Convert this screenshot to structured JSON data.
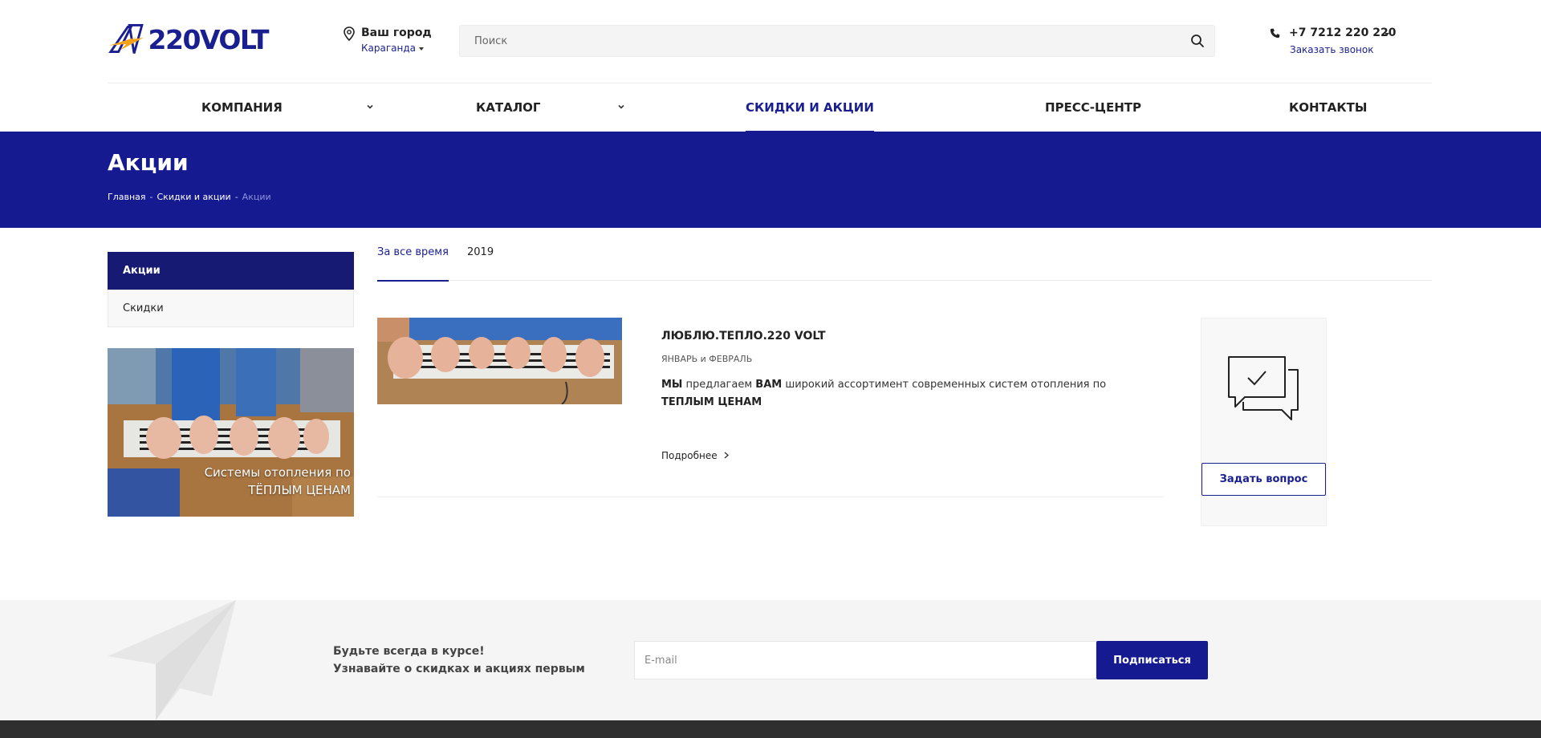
{
  "header": {
    "logo_text": "220VOLT",
    "city_label": "Ваш город",
    "city_value": "Караганда",
    "search_placeholder": "Поиск",
    "phone": "+7 7212 220 220",
    "callback": "Заказать звонок"
  },
  "nav": {
    "items": [
      {
        "label": "КОМПАНИЯ",
        "has_dropdown": true
      },
      {
        "label": "КАТАЛОГ",
        "has_dropdown": true
      },
      {
        "label": "СКИДКИ И АКЦИИ",
        "active": true
      },
      {
        "label": "ПРЕСС-ЦЕНТР"
      },
      {
        "label": "КОНТАКТЫ"
      }
    ]
  },
  "banner": {
    "title": "Акции",
    "breadcrumb": [
      "Главная",
      "Скидки и акции",
      "Акции"
    ],
    "separator": "-"
  },
  "sidebar": {
    "items": [
      {
        "label": "Акции",
        "active": true
      },
      {
        "label": "Скидки"
      }
    ],
    "promo_line1": "Системы отопления по",
    "promo_line2": "ТЁПЛЫМ ЦЕНАМ"
  },
  "tabs": [
    {
      "label": "За все время",
      "active": true
    },
    {
      "label": "2019"
    }
  ],
  "article": {
    "title": "ЛЮБЛЮ.ТЕПЛО.220 VOLT",
    "period": "ЯНВАРЬ и ФЕВРАЛЬ",
    "desc_1": "МЫ",
    "desc_2": " предлагаем ",
    "desc_3": "ВАМ",
    "desc_4": " широкий ассортимент современных систем отопления по ",
    "desc_5": "ТЕПЛЫМ ЦЕНАМ",
    "more": "Подробнее"
  },
  "ask": {
    "button": "Задать вопрос"
  },
  "subscribe": {
    "line1": "Будьте всегда в курсе!",
    "line2": "Узнавайте о скидках и акциях первым",
    "email_placeholder": "E-mail",
    "button": "Подписаться"
  },
  "colors": {
    "brand": "#161a91",
    "accent": "#f4a21c"
  }
}
